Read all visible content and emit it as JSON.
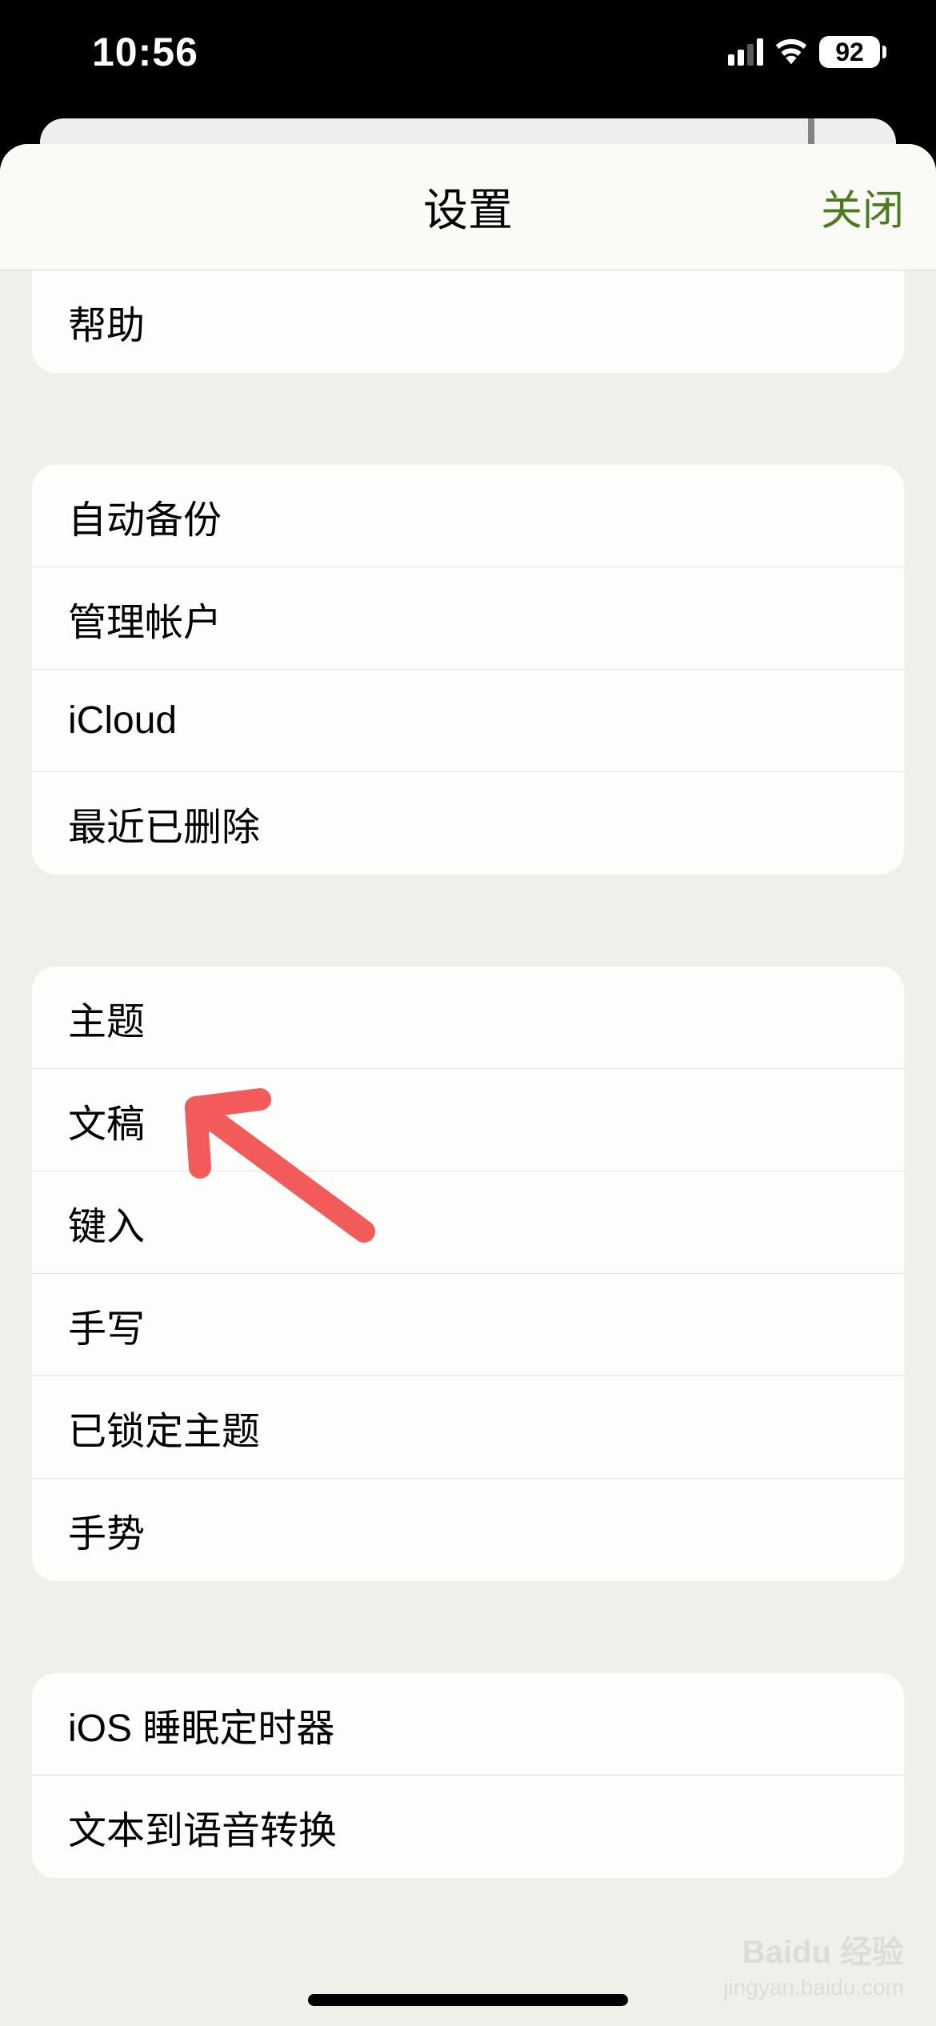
{
  "status": {
    "time": "10:56",
    "battery": "92"
  },
  "sheet": {
    "title": "设置",
    "close": "关闭"
  },
  "groups": {
    "g0": {
      "help": "帮助"
    },
    "g1": {
      "autoBackup": "自动备份",
      "manageAccount": "管理帐户",
      "icloud": "iCloud",
      "recentlyDeleted": "最近已删除"
    },
    "g2": {
      "theme": "主题",
      "document": "文稿",
      "typing": "键入",
      "handwriting": "手写",
      "lockedTheme": "已锁定主题",
      "gesture": "手势"
    },
    "g3": {
      "sleepTimer": "iOS 睡眠定时器",
      "tts": "文本到语音转换"
    }
  },
  "watermark": {
    "main": "Baidu 经验",
    "sub": "jingyan.baidu.com"
  }
}
